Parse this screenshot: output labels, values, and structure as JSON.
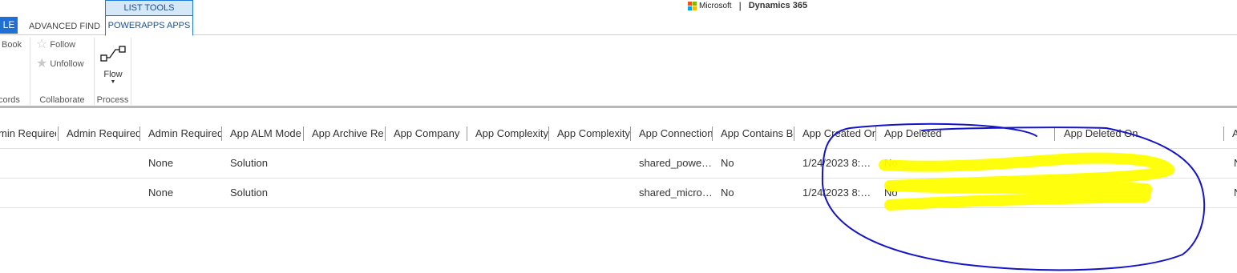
{
  "tabs": {
    "file_label": "LE",
    "advanced_find": "ADVANCED FIND",
    "context_group": "LIST TOOLS",
    "context_tab": "POWERAPPS APPS"
  },
  "brand": {
    "company": "Microsoft",
    "separator": "|",
    "product": "Dynamics 365",
    "logo_colors": [
      "#f25022",
      "#7fba00",
      "#00a4ef",
      "#ffb900"
    ]
  },
  "ribbon": {
    "records_item": "Book",
    "records_group_label": "cords",
    "follow": "Follow",
    "unfollow": "Unfollow",
    "collaborate_label": "Collaborate",
    "flow": "Flow",
    "process_label": "Process"
  },
  "grid": {
    "columns": [
      "min Required",
      "Admin Required",
      "Admin Required",
      "App ALM Mode",
      "App Archive Re",
      "App Company",
      "App Complexity",
      "App Complexity",
      "App Connections",
      "App Contains B",
      "App Created On",
      "App Deleted",
      "App Deleted On",
      "A"
    ],
    "rows": [
      [
        "",
        "",
        "None",
        "Solution",
        "",
        "",
        "",
        "",
        "shared_powe…",
        "No",
        "1/24/2023 8:…",
        "No",
        "",
        "N"
      ],
      [
        "",
        "",
        "None",
        "Solution",
        "",
        "",
        "",
        "",
        "shared_micro…",
        "No",
        "1/24/2023 8:…",
        "No",
        "",
        "N"
      ]
    ]
  },
  "annotation": {
    "circle_color": "#1414c8",
    "highlight_color": "#ffff00"
  }
}
